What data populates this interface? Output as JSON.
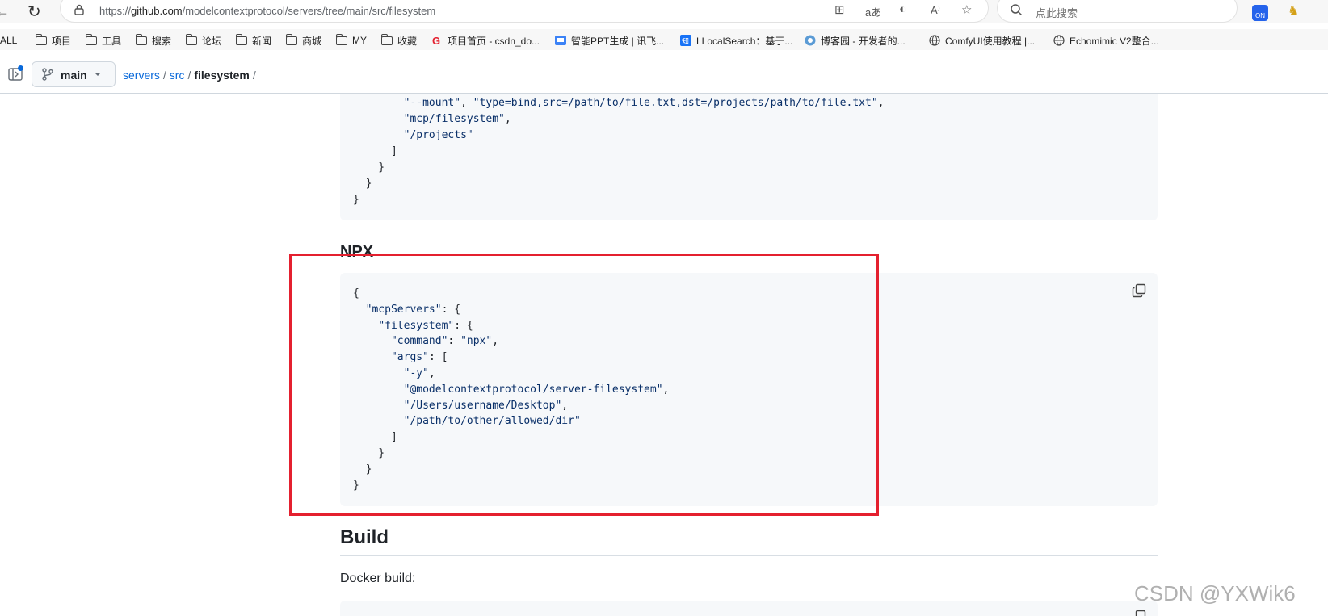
{
  "browser": {
    "url_prefix": "https://",
    "url_domain": "github.com",
    "url_path": "/modelcontextprotocol/servers/tree/main/src/filesystem",
    "search_placeholder": "点此搜索",
    "extension_badge": "ON"
  },
  "bookmarks": [
    {
      "label": "ALL",
      "icon": "none"
    },
    {
      "label": "项目",
      "icon": "folder-icon"
    },
    {
      "label": "工具",
      "icon": "folder-icon"
    },
    {
      "label": "搜索",
      "icon": "folder-icon"
    },
    {
      "label": "论坛",
      "icon": "folder-icon"
    },
    {
      "label": "新闻",
      "icon": "folder-icon"
    },
    {
      "label": "商城",
      "icon": "folder-icon"
    },
    {
      "label": "MY",
      "icon": "folder-icon"
    },
    {
      "label": "收藏",
      "icon": "folder-icon"
    },
    {
      "label": "项目首页 - csdn_do...",
      "icon": "csdn-icon"
    },
    {
      "label": "智能PPT生成 | 讯飞...",
      "icon": "ppt-icon"
    },
    {
      "label": "LLocalSearch：基于...",
      "icon": "zhihu-icon"
    },
    {
      "label": "博客园 - 开发者的...",
      "icon": "cnblogs-icon"
    },
    {
      "label": "ComfyUI使用教程 |...",
      "icon": "globe-icon"
    },
    {
      "label": "Echomimic V2整合...",
      "icon": "globe-icon"
    }
  ],
  "github": {
    "branch": "main",
    "breadcrumb": [
      "servers",
      "src",
      "filesystem"
    ],
    "sep": "/"
  },
  "code_top_lines": [
    "        \"--mount\", \"type=bind,src=/path/to/file.txt,dst=/projects/path/to/file.txt\",",
    "        \"mcp/filesystem\",",
    "        \"/projects\"",
    "      ]",
    "    }",
    "  }",
    "}"
  ],
  "npx_heading": "NPX",
  "npx_code_lines": [
    "{",
    "  \"mcpServers\": {",
    "    \"filesystem\": {",
    "      \"command\": \"npx\",",
    "      \"args\": [",
    "        \"-y\",",
    "        \"@modelcontextprotocol/server-filesystem\",",
    "        \"/Users/username/Desktop\",",
    "        \"/path/to/other/allowed/dir\"",
    "      ]",
    "    }",
    "  }",
    "}"
  ],
  "build_heading": "Build",
  "docker_text": "Docker build:",
  "watermark": "CSDN @YXWik6",
  "colors": {
    "link": "#0969da",
    "code_bg": "#f6f8fa",
    "highlight": "#e4202f",
    "string": "#0a3069"
  }
}
